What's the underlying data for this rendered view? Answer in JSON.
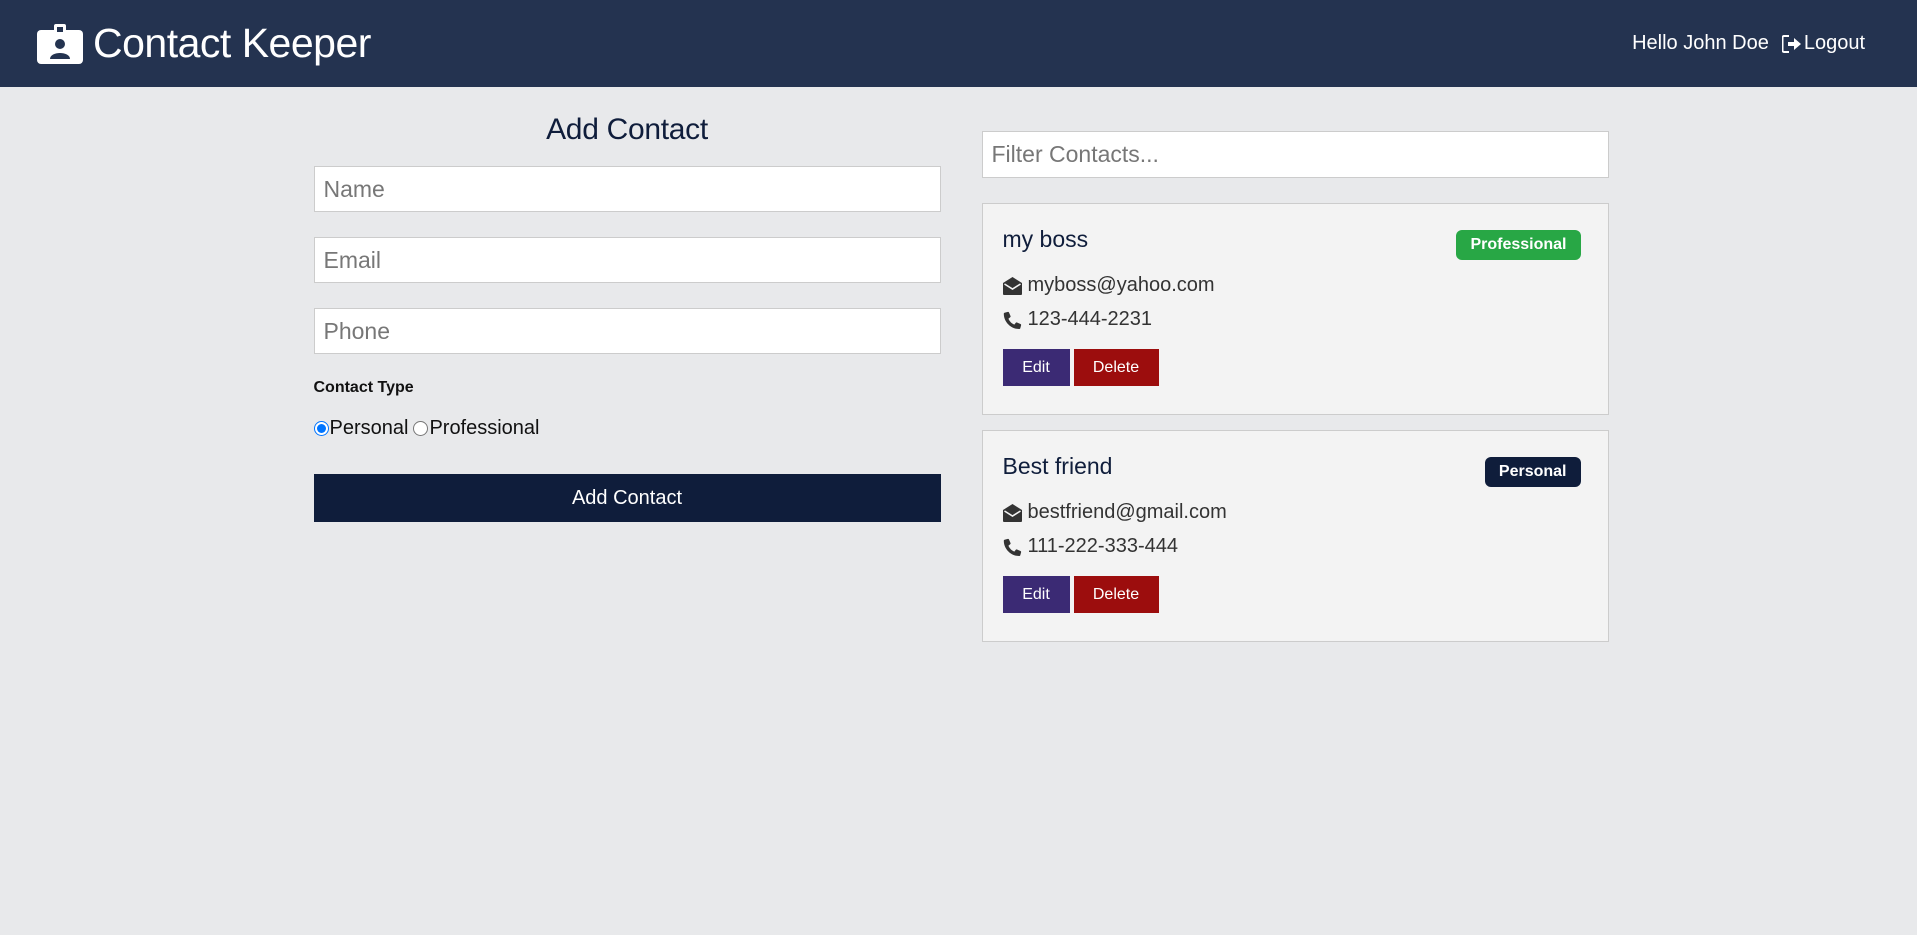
{
  "navbar": {
    "title": "Contact Keeper",
    "brand_icon": "id-badge-icon",
    "greeting": "Hello John Doe",
    "logout_label": "Logout",
    "logout_icon": "sign-out-icon",
    "background": "#243350"
  },
  "form": {
    "title": "Add Contact",
    "name_placeholder": "Name",
    "email_placeholder": "Email",
    "phone_placeholder": "Phone",
    "name_value": "",
    "email_value": "",
    "phone_value": "",
    "type_label": "Contact Type",
    "options": [
      {
        "label": "Personal",
        "checked": true
      },
      {
        "label": "Professional",
        "checked": false
      }
    ],
    "submit_label": "Add Contact"
  },
  "contacts": {
    "filter_placeholder": "Filter Contacts...",
    "items": [
      {
        "name": "my boss",
        "badge": "Professional",
        "badge_color": "#28a745",
        "email": "myboss@yahoo.com",
        "phone": "123-444-2231",
        "edit_label": "Edit",
        "delete_label": "Delete"
      },
      {
        "name": "Best friend",
        "badge": "Personal",
        "badge_color": "#0f1d3b",
        "email": "bestfriend@gmail.com",
        "phone": "111-222-333-444",
        "edit_label": "Edit",
        "delete_label": "Delete"
      }
    ]
  },
  "colors": {
    "primary": "#0f1d3b",
    "edit": "#3b2a74",
    "danger": "#9c0d0d",
    "success": "#28a745",
    "page_bg": "#e8e9eb"
  }
}
